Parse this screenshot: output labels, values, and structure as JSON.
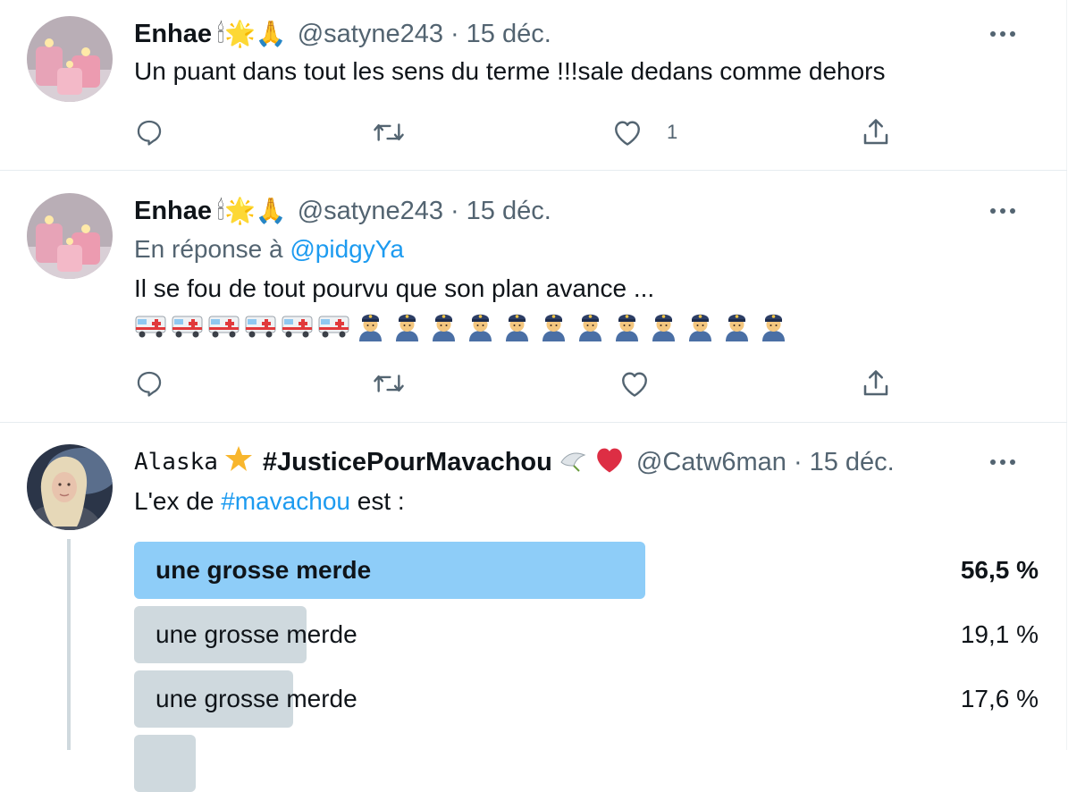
{
  "tweets": [
    {
      "name": "Enhae",
      "name_emojis": "🕯🌟🙏",
      "handle": "@satyne243",
      "separator": "·",
      "date": "15 déc.",
      "text": "Un puant dans tout les sens du terme !!!sale dedans comme dehors",
      "like_count": "1"
    },
    {
      "name": "Enhae",
      "name_emojis": "🕯🌟🙏",
      "handle": "@satyne243",
      "separator": "·",
      "date": "15 déc.",
      "reply_prefix": "En réponse à",
      "reply_handle": "@pidgyYa",
      "text": "Il se fou de tout pourvu que son plan avance ...",
      "emoji_line": [
        "ambulance",
        "ambulance",
        "ambulance",
        "ambulance",
        "ambulance",
        "ambulance",
        "police-officer",
        "police-officer",
        "police-officer",
        "police-officer",
        "police-officer",
        "police-officer",
        "police-officer",
        "police-officer",
        "police-officer",
        "police-officer",
        "police-officer",
        "police-officer"
      ]
    },
    {
      "name": "Alaska",
      "hashtag_name": "#JusticePourMavachou",
      "handle": "@Catw6man",
      "separator": "·",
      "date": "15 déc.",
      "text_before": "L'ex de",
      "text_hashtag": "#mavachou",
      "text_after": "est :",
      "poll": [
        {
          "label": "une grosse merde",
          "percent_text": "56,5 %",
          "percent": 56.5,
          "winner": true
        },
        {
          "label": "une grosse merde",
          "percent_text": "19,1 %",
          "percent": 19.1,
          "winner": false
        },
        {
          "label": "une grosse merde",
          "percent_text": "17,6 %",
          "percent": 17.6,
          "winner": false
        },
        {
          "label": "",
          "percent_text": "",
          "percent": 6.8,
          "winner": false
        }
      ]
    }
  ],
  "colors": {
    "accent": "#1d9bf0",
    "secondary_text": "#536471",
    "poll_winner": "#8ecdf8",
    "poll_other": "#cfd9de"
  }
}
